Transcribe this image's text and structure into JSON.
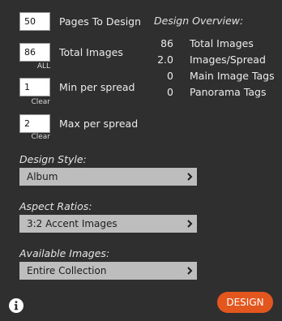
{
  "settings": {
    "pages": {
      "value": "50",
      "label": "Pages To Design"
    },
    "total_images": {
      "value": "86",
      "label": "Total Images",
      "link": "ALL"
    },
    "min_per_spread": {
      "value": "1",
      "label": "Min per spread",
      "link": "Clear"
    },
    "max_per_spread": {
      "value": "2",
      "label": "Max per spread",
      "link": "Clear"
    }
  },
  "overview": {
    "title": "Design Overview:",
    "rows": [
      {
        "value": "86",
        "label": "Total Images"
      },
      {
        "value": "2.0",
        "label": "Images/Spread"
      },
      {
        "value": "0",
        "label": "Main Image Tags"
      },
      {
        "value": "0",
        "label": "Panorama Tags"
      }
    ]
  },
  "design_style": {
    "label": "Design Style:",
    "selected": "Album"
  },
  "aspect_ratios": {
    "label": "Aspect Ratios:",
    "selected": "3:2 Accent Images"
  },
  "available_images": {
    "label": "Available Images:",
    "selected": "Entire Collection"
  },
  "design_button": {
    "label": "DESIGN"
  },
  "colors": {
    "background": "#2f2f2f",
    "dropdown": "#bdbdbd",
    "accent": "#e3571f"
  },
  "icons": {
    "info": "info-icon",
    "dropdown_arrow": "chevron-right-icon"
  }
}
